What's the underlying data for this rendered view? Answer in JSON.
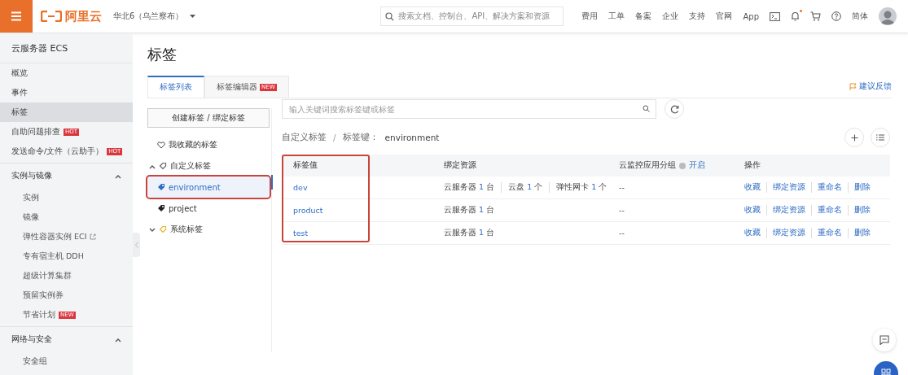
{
  "topbar": {
    "logo": "阿里云",
    "region": "华北6（乌兰察布）",
    "search_placeholder": "搜索文档、控制台、API、解决方案和资源",
    "links": [
      "费用",
      "工单",
      "备案",
      "企业",
      "支持",
      "官网",
      "App"
    ],
    "notification_dot": true,
    "language": "简体"
  },
  "sidebar": {
    "title": "云服务器 ECS",
    "items": [
      {
        "kind": "item",
        "label": "概览",
        "selected": false
      },
      {
        "kind": "item",
        "label": "事件",
        "selected": false
      },
      {
        "kind": "item",
        "label": "标签",
        "selected": true
      },
      {
        "kind": "item",
        "label": "自助问题排查",
        "badge": "HOT",
        "selected": false
      },
      {
        "kind": "item",
        "label": "发送命令/文件（云助手）",
        "badge": "HOT",
        "selected": false
      },
      {
        "kind": "section",
        "label": "实例与镜像",
        "expanded": true,
        "children": [
          {
            "label": "实例",
            "selected": false
          },
          {
            "label": "镜像",
            "selected": false
          },
          {
            "label": "弹性容器实例 ECI",
            "external": true,
            "selected": false
          },
          {
            "label": "专有宿主机 DDH",
            "selected": false
          },
          {
            "label": "超级计算集群",
            "selected": false
          },
          {
            "label": "预留实例券",
            "selected": false
          },
          {
            "label": "节省计划",
            "badge": "NEW",
            "selected": false
          }
        ]
      },
      {
        "kind": "section",
        "label": "网络与安全",
        "expanded": true,
        "children": [
          {
            "label": "安全组",
            "selected": false
          }
        ]
      }
    ]
  },
  "page": {
    "title": "标签",
    "tabs": [
      {
        "label": "标签列表",
        "selected": true
      },
      {
        "label": "标签编辑器",
        "badge": "NEW",
        "selected": false
      }
    ],
    "feedback": "建议反馈"
  },
  "tag_tree": {
    "create_button": "创建标签 / 绑定标签",
    "favorites": "我收藏的标签",
    "groups": [
      {
        "label": "自定义标签",
        "kind": "custom",
        "expanded": true,
        "children": [
          {
            "label": "environment",
            "selected": true
          },
          {
            "label": "project",
            "selected": false
          }
        ]
      },
      {
        "label": "系统标签",
        "kind": "system",
        "expanded": false
      }
    ]
  },
  "search": {
    "placeholder": "输入关键词搜索标签键或标签"
  },
  "breadcrumb": [
    "自定义标签",
    "/",
    "标签键：",
    "environment"
  ],
  "table": {
    "columns": [
      "标签值",
      "绑定资源",
      "云监控应用分组",
      "操作"
    ],
    "column_link": "开启",
    "rows": [
      {
        "value": "dev",
        "resources": [
          {
            "label": "云服务器",
            "count": "1",
            "unit": "台"
          },
          {
            "label": "云盘",
            "count": "1",
            "unit": "个"
          },
          {
            "label": "弹性网卡",
            "count": "1",
            "unit": "个"
          }
        ],
        "group": "--",
        "actions": [
          "收藏",
          "绑定资源",
          "重命名",
          "删除"
        ]
      },
      {
        "value": "product",
        "resources": [
          {
            "label": "云服务器",
            "count": "1",
            "unit": "台"
          }
        ],
        "group": "--",
        "actions": [
          "收藏",
          "绑定资源",
          "重命名",
          "删除"
        ]
      },
      {
        "value": "test",
        "resources": [
          {
            "label": "云服务器",
            "count": "1",
            "unit": "台"
          }
        ],
        "group": "--",
        "actions": [
          "收藏",
          "绑定资源",
          "重命名",
          "删除"
        ]
      }
    ]
  }
}
